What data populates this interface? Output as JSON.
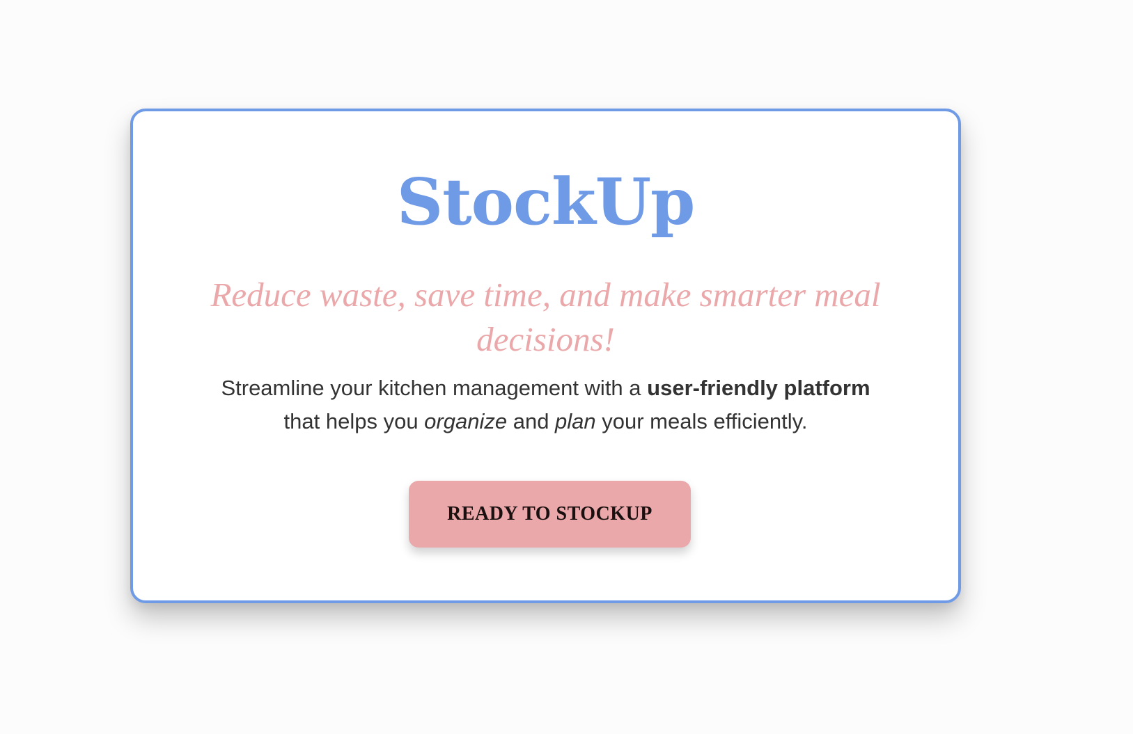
{
  "hero": {
    "title": "StockUp",
    "tagline": "Reduce waste, save time, and make smarter meal decisions!",
    "description": {
      "part1": "Streamline your kitchen management with a ",
      "bold": "user-friendly platform",
      "part2": " that helps you ",
      "italic1": "organize",
      "part3": " and ",
      "italic2": "plan",
      "part4": " your meals efficiently."
    },
    "cta_label": "READY TO STOCKUP"
  },
  "colors": {
    "accent_blue": "#6f9ae6",
    "accent_pink": "#eba8aa",
    "text_dark": "#333333",
    "button_text": "#1a1010"
  }
}
